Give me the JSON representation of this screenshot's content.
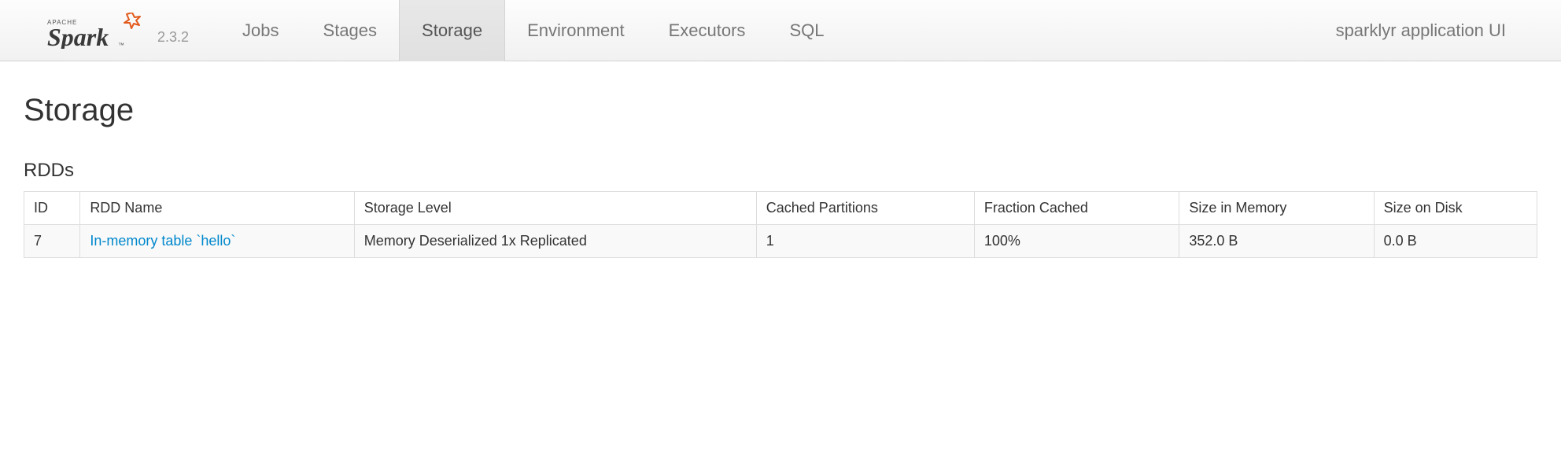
{
  "brand": {
    "name": "Apache Spark",
    "version": "2.3.2"
  },
  "nav": {
    "items": [
      {
        "label": "Jobs",
        "active": false
      },
      {
        "label": "Stages",
        "active": false
      },
      {
        "label": "Storage",
        "active": true
      },
      {
        "label": "Environment",
        "active": false
      },
      {
        "label": "Executors",
        "active": false
      },
      {
        "label": "SQL",
        "active": false
      }
    ],
    "app_title": "sparklyr application UI"
  },
  "page": {
    "title": "Storage",
    "section_title": "RDDs"
  },
  "table": {
    "headers": [
      "ID",
      "RDD Name",
      "Storage Level",
      "Cached Partitions",
      "Fraction Cached",
      "Size in Memory",
      "Size on Disk"
    ],
    "rows": [
      {
        "id": "7",
        "rdd_name": "In-memory table `hello`",
        "storage_level": "Memory Deserialized 1x Replicated",
        "cached_partitions": "1",
        "fraction_cached": "100%",
        "size_in_memory": "352.0 B",
        "size_on_disk": "0.0 B"
      }
    ]
  }
}
